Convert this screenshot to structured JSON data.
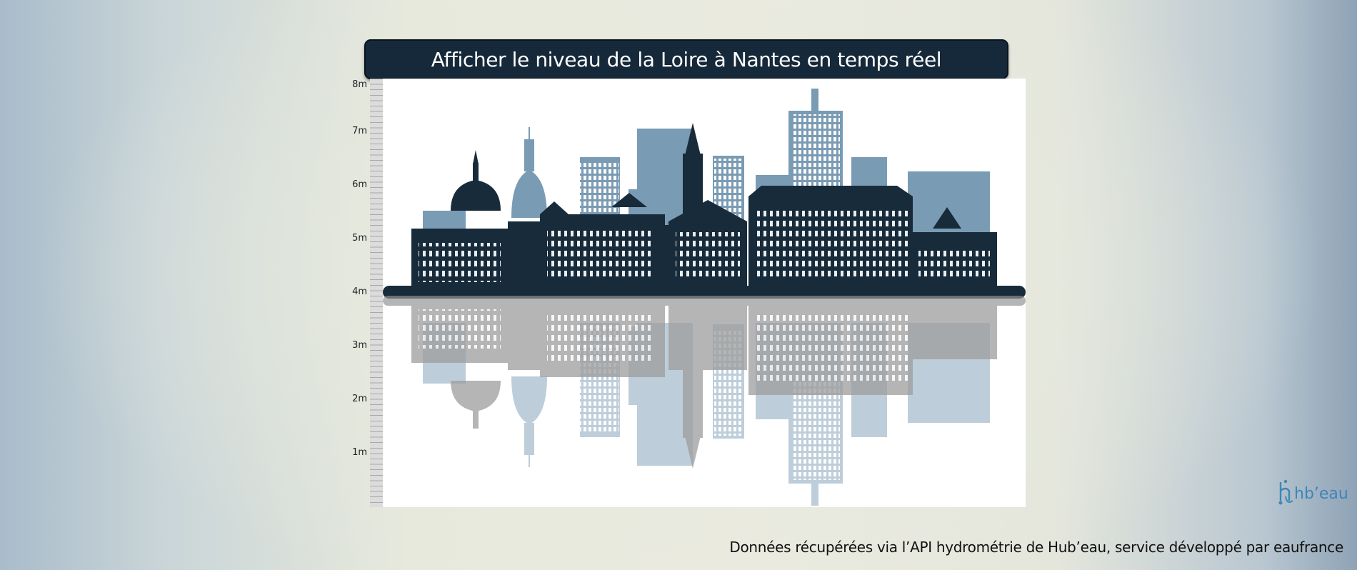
{
  "header": {
    "title": "Afficher le niveau de la Loire à Nantes en temps réel"
  },
  "gauge": {
    "tick_labels": [
      "8m",
      "7m",
      "6m",
      "5m",
      "4m",
      "3m",
      "2m",
      "1m"
    ],
    "icon": "water-level-ruler-icon"
  },
  "illustration": {
    "icon": "nantes-skyline-reflection-illustration"
  },
  "logo": {
    "text": "hb’eau",
    "icon": "hubeau-logo-icon"
  },
  "footer": {
    "text": "Données récupérées via l’API hydrométrie de Hub’eau, service développé par eaufrance"
  },
  "colors": {
    "title_bg": "#16293a",
    "skyline_dark": "#182b3a",
    "skyline_light": "#7a9bb4",
    "reflection_grey": "#8a9399",
    "reflection_light": "#b8cad6",
    "logo": "#3c86b8"
  }
}
